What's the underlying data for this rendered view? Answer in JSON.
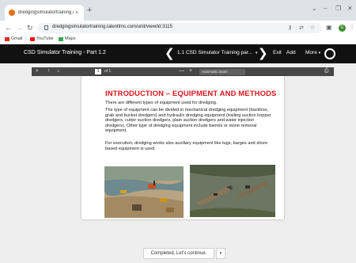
{
  "browser": {
    "tab_title": "dredgingsimulatortraining.c...",
    "tab_close": "×",
    "new_tab": "+",
    "url": "dredgingsimulatortraining.talentlms.com/unit/view/id:3115",
    "bookmarks": [
      {
        "label": "Gmail"
      },
      {
        "label": "YouTube"
      },
      {
        "label": "Maps"
      }
    ],
    "avatar_letter": "G"
  },
  "app": {
    "course_title": "CSD Simulator Training - Part 1.2",
    "prev_arrow": "❮",
    "next_arrow": "❯",
    "unit_title": "1.1 CSD Simulator Training par...",
    "unit_caret": "▾",
    "exit_label": "Exit",
    "add_label": "Add",
    "more_label": "More",
    "more_caret": "▾"
  },
  "pdf_viewer": {
    "page_number": "1",
    "page_total": "of 1",
    "zoom_value": "Automatic Zoom",
    "zoom_minus": "—",
    "zoom_plus": "+"
  },
  "document": {
    "heading": "INTRODUCTION – EQUIPMENT AND METHODS",
    "paragraphs": [
      "There are different types of equipment used for dredging.",
      "The type of equipment can be divided in mechanical dredging equipment (backhoe, grab and bucket dredgers) and hydraulic dredging equipment (trailing suction hopper dredgers, cutter suction dredgers, plain suction dredgers and water injection dredgers). Other type of dredging equipment include barrels or stone removal equipment.",
      "For execution, dredging works also auxiliary equipment like tugs, barges and shore based equipment is used."
    ]
  },
  "footer": {
    "complete_label": "Completed. Let's continue.",
    "complete_caret": "▾"
  },
  "colors": {
    "heading": "#e0181f",
    "toolbar": "#111111",
    "workarea": "#eeeeee"
  }
}
